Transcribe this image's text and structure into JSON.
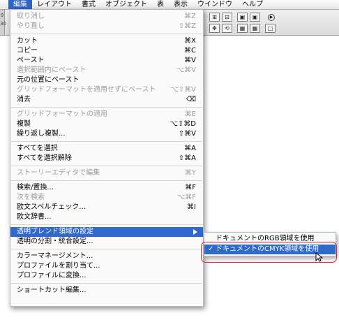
{
  "menubar": {
    "items": [
      "編集",
      "レイアウト",
      "書式",
      "オブジェクト",
      "表",
      "表示",
      "ウインドウ",
      "ヘルプ"
    ],
    "active_index": 0
  },
  "menu": {
    "items": [
      {
        "label": "取り消し",
        "shortcut": "⌘Z",
        "disabled": true
      },
      {
        "label": "やり直し",
        "shortcut": "⇧⌘Z",
        "disabled": true
      },
      {
        "separator": true
      },
      {
        "label": "カット",
        "shortcut": "⌘X",
        "disabled": false
      },
      {
        "label": "コピー",
        "shortcut": "⌘C",
        "disabled": false
      },
      {
        "label": "ペースト",
        "shortcut": "⌘V",
        "disabled": false
      },
      {
        "label": "選択範囲内にペースト",
        "shortcut": "⌥⌘V",
        "disabled": true
      },
      {
        "label": "元の位置にペースト",
        "shortcut": "",
        "disabled": false
      },
      {
        "label": "グリッドフォーマットを適用せずにペースト",
        "shortcut": "⌥⇧⌘V",
        "disabled": true
      },
      {
        "label": "消去",
        "shortcut": "⌫",
        "disabled": false
      },
      {
        "separator": true
      },
      {
        "label": "グリッドフォーマットの適用",
        "shortcut": "⌘E",
        "disabled": true
      },
      {
        "label": "複製",
        "shortcut": "⌥⇧⌘D",
        "disabled": false
      },
      {
        "label": "繰り返し複製...",
        "shortcut": "⇧⌘V",
        "disabled": false
      },
      {
        "separator": true
      },
      {
        "label": "すべてを選択",
        "shortcut": "⌘A",
        "disabled": false
      },
      {
        "label": "すべてを選択解除",
        "shortcut": "⇧⌘A",
        "disabled": false
      },
      {
        "separator": true
      },
      {
        "label": "ストーリーエディタで編集",
        "shortcut": "⌘Y",
        "disabled": true
      },
      {
        "separator": true
      },
      {
        "label": "検索/置換...",
        "shortcut": "⌘F",
        "disabled": false
      },
      {
        "label": "次を検索",
        "shortcut": "⌥⌘F",
        "disabled": true
      },
      {
        "label": "欧文スペルチェック...",
        "shortcut": "⌘I",
        "disabled": false
      },
      {
        "label": "欧文辞書...",
        "shortcut": "",
        "disabled": false
      },
      {
        "separator": true
      },
      {
        "label": "透明ブレンド領域の設定",
        "shortcut": "",
        "disabled": false,
        "highlighted": true,
        "submenu": true
      },
      {
        "label": "透明の分割・統合設定...",
        "shortcut": "",
        "disabled": false
      },
      {
        "separator": true
      },
      {
        "label": "カラーマネージメント...",
        "shortcut": "",
        "disabled": false
      },
      {
        "label": "プロファイルを割り当て...",
        "shortcut": "",
        "disabled": false
      },
      {
        "label": "プロファイルに変換...",
        "shortcut": "",
        "disabled": false
      },
      {
        "separator": true
      },
      {
        "label": "ショートカット編集...",
        "shortcut": "",
        "disabled": false
      }
    ]
  },
  "submenu": {
    "items": [
      {
        "label": "ドキュメントのRGB領域を使用",
        "checked": false,
        "highlighted": false
      },
      {
        "label": "ドキュメントのCMYK領域を使用",
        "checked": true,
        "highlighted": true
      }
    ],
    "check_mark": "✓"
  },
  "toolbar": {
    "left_labels": [
      "9",
      "30"
    ]
  }
}
